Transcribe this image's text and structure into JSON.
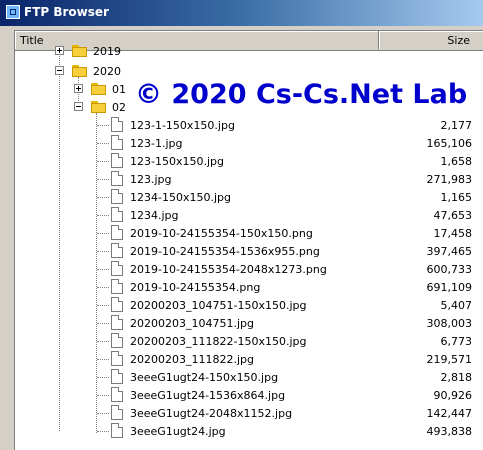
{
  "window": {
    "title": "FTP Browser"
  },
  "columns": {
    "title": "Title",
    "size": "Size"
  },
  "folders": [
    {
      "label": "2019",
      "expanded": false
    },
    {
      "label": "2020",
      "expanded": true
    },
    {
      "label": "01",
      "expanded": false
    },
    {
      "label": "02",
      "expanded": true
    }
  ],
  "files": [
    {
      "name": "123-1-150x150.jpg",
      "size": "2,177"
    },
    {
      "name": "123-1.jpg",
      "size": "165,106"
    },
    {
      "name": "123-150x150.jpg",
      "size": "1,658"
    },
    {
      "name": "123.jpg",
      "size": "271,983"
    },
    {
      "name": "1234-150x150.jpg",
      "size": "1,165"
    },
    {
      "name": "1234.jpg",
      "size": "47,653"
    },
    {
      "name": "2019-10-24155354-150x150.png",
      "size": "17,458"
    },
    {
      "name": "2019-10-24155354-1536x955.png",
      "size": "397,465"
    },
    {
      "name": "2019-10-24155354-2048x1273.png",
      "size": "600,733"
    },
    {
      "name": "2019-10-24155354.png",
      "size": "691,109"
    },
    {
      "name": "20200203_104751-150x150.jpg",
      "size": "5,407"
    },
    {
      "name": "20200203_104751.jpg",
      "size": "308,003"
    },
    {
      "name": "20200203_111822-150x150.jpg",
      "size": "6,773"
    },
    {
      "name": "20200203_111822.jpg",
      "size": "219,571"
    },
    {
      "name": "3eeeG1ugt24-150x150.jpg",
      "size": "2,818"
    },
    {
      "name": "3eeeG1ugt24-1536x864.jpg",
      "size": "90,926"
    },
    {
      "name": "3eeeG1ugt24-2048x1152.jpg",
      "size": "142,447"
    },
    {
      "name": "3eeeG1ugt24.jpg",
      "size": "493,838"
    }
  ],
  "watermark": "© 2020 Cs-Cs.Net Lab",
  "colors": {
    "titlebar_start": "#0a246a",
    "watermark": "#0000cc",
    "folder": "#f6cf3c"
  }
}
